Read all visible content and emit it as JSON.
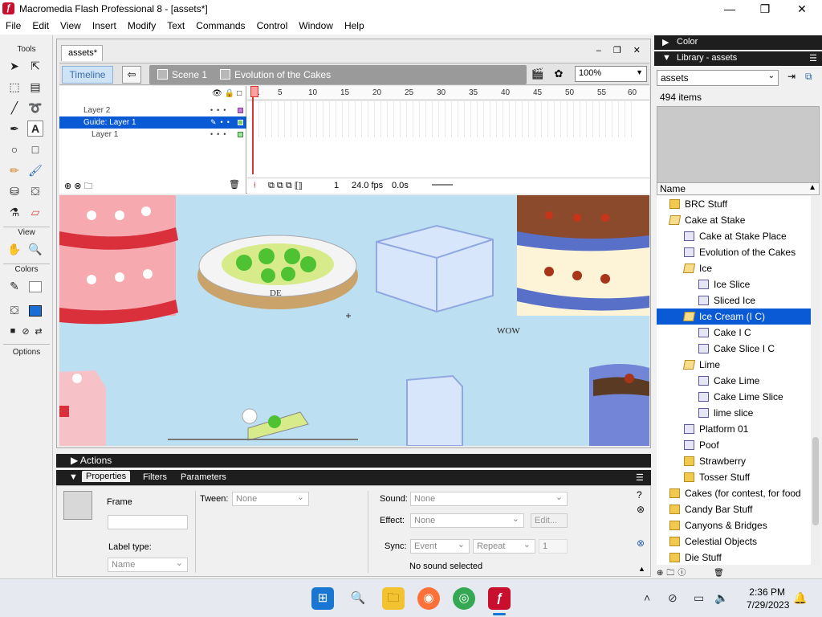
{
  "window": {
    "title": "Macromedia Flash Professional 8 - [assets*]",
    "app_icon": "ƒ",
    "minimize": "—",
    "maximize": "❐",
    "close": "✕"
  },
  "menu": [
    "File",
    "Edit",
    "View",
    "Insert",
    "Modify",
    "Text",
    "Commands",
    "Control",
    "Window",
    "Help"
  ],
  "tools": {
    "header": "Tools",
    "view": "View",
    "colors": "Colors",
    "options": "Options"
  },
  "document": {
    "tab": "assets*",
    "controls": "– ❐ ✕",
    "timeline_button": "Timeline",
    "scene": "Scene 1",
    "symbol": "Evolution of the Cakes",
    "zoom": "100%",
    "layers": [
      {
        "name": "Layer 2",
        "selected": false,
        "color": "#8e3ba0"
      },
      {
        "name": "Guide: Layer 1",
        "selected": true,
        "color": "#3c8b3c"
      },
      {
        "name": "Layer 1",
        "selected": false,
        "color": "#3c8b3c"
      }
    ],
    "ruler_ticks": [
      "1",
      "5",
      "10",
      "15",
      "20",
      "25",
      "30",
      "35",
      "40",
      "45",
      "50",
      "55",
      "60"
    ],
    "frame": "1",
    "fps": "24.0 fps",
    "time": "0.0s",
    "stage_text": {
      "de": "DE",
      "wow": "WOW"
    }
  },
  "actions_label": "Actions",
  "properties": {
    "tabs": [
      "Properties",
      "Filters",
      "Parameters"
    ],
    "frame_label": "Frame",
    "tween_label": "Tween:",
    "tween_value": "None",
    "sound_label": "Sound:",
    "sound_value": "None",
    "effect_label": "Effect:",
    "effect_value": "None",
    "edit_button": "Edit...",
    "label_type_label": "Label type:",
    "label_type_value": "Name",
    "sync_label": "Sync:",
    "sync_value": "Event",
    "repeat_value": "Repeat",
    "repeat_count": "1",
    "no_sound": "No sound selected"
  },
  "panels": {
    "color": "Color",
    "library": "Library - assets",
    "library_select": "assets",
    "item_count": "494 items",
    "name_header": "Name",
    "items": [
      {
        "label": "BRC Stuff",
        "type": "folder",
        "indent": 1,
        "selected": false
      },
      {
        "label": "Cake at Stake",
        "type": "ofolder",
        "indent": 1,
        "selected": false
      },
      {
        "label": "Cake at Stake Place",
        "type": "sym",
        "indent": 2,
        "selected": false
      },
      {
        "label": "Evolution of the Cakes",
        "type": "sym",
        "indent": 2,
        "selected": false
      },
      {
        "label": "Ice",
        "type": "ofolder",
        "indent": 2,
        "selected": false
      },
      {
        "label": "Ice Slice",
        "type": "sym",
        "indent": 3,
        "selected": false
      },
      {
        "label": "Sliced Ice",
        "type": "sym",
        "indent": 3,
        "selected": false
      },
      {
        "label": "Ice Cream (I C)",
        "type": "ofolder",
        "indent": 2,
        "selected": true
      },
      {
        "label": "Cake I C",
        "type": "sym",
        "indent": 3,
        "selected": false
      },
      {
        "label": "Cake Slice I C",
        "type": "sym",
        "indent": 3,
        "selected": false
      },
      {
        "label": "Lime",
        "type": "ofolder",
        "indent": 2,
        "selected": false
      },
      {
        "label": "Cake Lime",
        "type": "sym",
        "indent": 3,
        "selected": false
      },
      {
        "label": "Cake Lime Slice",
        "type": "sym",
        "indent": 3,
        "selected": false
      },
      {
        "label": "lime slice",
        "type": "sym",
        "indent": 3,
        "selected": false
      },
      {
        "label": "Platform 01",
        "type": "sym",
        "indent": 2,
        "selected": false
      },
      {
        "label": "Poof",
        "type": "sym",
        "indent": 2,
        "selected": false
      },
      {
        "label": "Strawberry",
        "type": "folder",
        "indent": 2,
        "selected": false
      },
      {
        "label": "Tosser Stuff",
        "type": "folder",
        "indent": 2,
        "selected": false
      },
      {
        "label": "Cakes (for contest, for food",
        "type": "folder",
        "indent": 1,
        "selected": false
      },
      {
        "label": "Candy Bar Stuff",
        "type": "folder",
        "indent": 1,
        "selected": false
      },
      {
        "label": "Canyons & Bridges",
        "type": "folder",
        "indent": 1,
        "selected": false
      },
      {
        "label": "Celestial Objects",
        "type": "folder",
        "indent": 1,
        "selected": false
      },
      {
        "label": "Die Stuff",
        "type": "folder",
        "indent": 1,
        "selected": false
      }
    ]
  },
  "taskbar": {
    "time": "2:36 PM",
    "date": "7/29/2023"
  },
  "colors": {
    "accent": "#0a5ad6",
    "stage": "#bcdff2",
    "panel_header": "#1e1e1e",
    "flash_red": "#c8102e"
  }
}
